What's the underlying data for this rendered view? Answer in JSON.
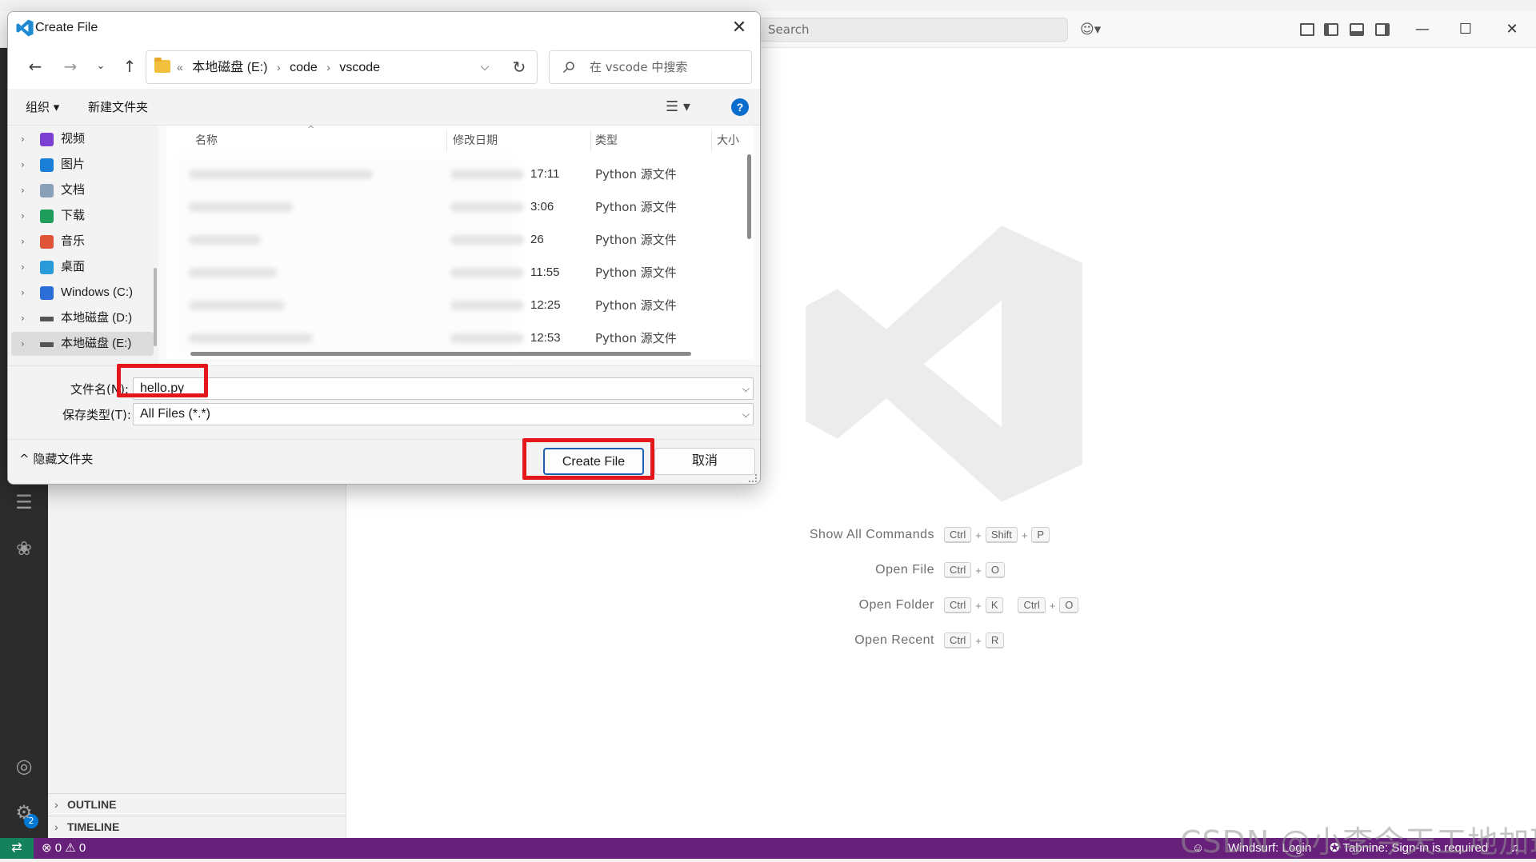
{
  "vscode": {
    "search_placeholder": "Search",
    "copilot_icon": "copilot-icon",
    "sidebar_sections": [
      "OUTLINE",
      "TIMELINE"
    ],
    "shortcuts": [
      {
        "label": "Show All Commands",
        "keys": [
          [
            "Ctrl",
            "Shift",
            "P"
          ]
        ]
      },
      {
        "label": "Open File",
        "keys": [
          [
            "Ctrl",
            "O"
          ]
        ]
      },
      {
        "label": "Open Folder",
        "keys": [
          [
            "Ctrl",
            "K"
          ],
          [
            "Ctrl",
            "O"
          ]
        ]
      },
      {
        "label": "Open Recent",
        "keys": [
          [
            "Ctrl",
            "R"
          ]
        ]
      }
    ],
    "status": {
      "errors": "0",
      "warnings": "0",
      "windsurf": "Windsurf: Login",
      "tabnine": "Tabnine: Sign-in is required"
    },
    "account_badge": "2",
    "accent": "#68217a",
    "remote_color": "#16825d"
  },
  "dialog": {
    "title": "Create File",
    "breadcrumb_prefix": "«",
    "breadcrumb": [
      "本地磁盘 (E:)",
      "code",
      "vscode"
    ],
    "search_placeholder": "在 vscode 中搜索",
    "toolbar": {
      "organize": "组织 ▾",
      "new_folder": "新建文件夹",
      "help": "?"
    },
    "nav_items": [
      {
        "label": "视频",
        "icon": "video-icon",
        "color": "#7b3fd1"
      },
      {
        "label": "图片",
        "icon": "pictures-icon",
        "color": "#1a7fd6"
      },
      {
        "label": "文档",
        "icon": "documents-icon",
        "color": "#8aa0b8"
      },
      {
        "label": "下载",
        "icon": "downloads-icon",
        "color": "#1e9e5a"
      },
      {
        "label": "音乐",
        "icon": "music-icon",
        "color": "#e0553a"
      },
      {
        "label": "桌面",
        "icon": "desktop-icon",
        "color": "#2a9bd9"
      },
      {
        "label": "Windows (C:)",
        "icon": "windows-drive-icon",
        "color": "#2b6fd6"
      },
      {
        "label": "本地磁盘 (D:)",
        "icon": "drive-icon",
        "color": "#555555"
      },
      {
        "label": "本地磁盘 (E:)",
        "icon": "drive-icon",
        "color": "#555555",
        "selected": true
      }
    ],
    "columns": [
      "名称",
      "修改日期",
      "类型",
      "大小"
    ],
    "files": [
      {
        "time": "17:11",
        "type": "Python 源文件"
      },
      {
        "time": "3:06",
        "type": "Python 源文件"
      },
      {
        "time": "26",
        "type": "Python 源文件"
      },
      {
        "time": "11:55",
        "type": "Python 源文件"
      },
      {
        "time": "12:25",
        "type": "Python 源文件"
      },
      {
        "time": "12:53",
        "type": "Python 源文件"
      }
    ],
    "filename_label": "文件名(N):",
    "filename_value": "hello.py",
    "filetype_label": "保存类型(T):",
    "filetype_value": "All Files (*.*)",
    "hide_folders": "隐藏文件夹",
    "create_button": "Create File",
    "cancel_button": "取消"
  },
  "watermark": "CSDN @小李今天工地加班",
  "highlight_color": "#e3161b"
}
